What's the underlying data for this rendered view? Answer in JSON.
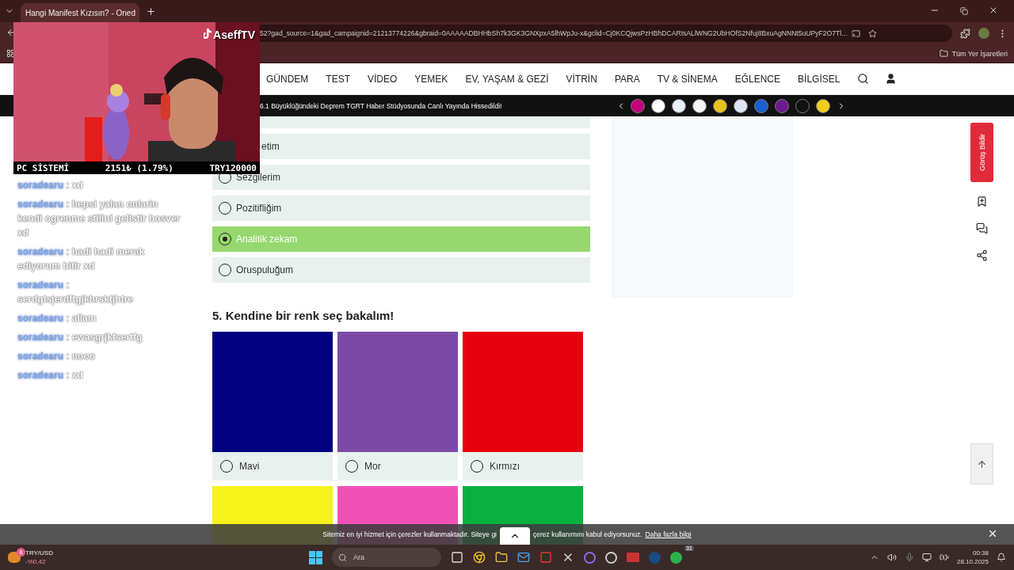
{
  "browser": {
    "tab_title": "Hangi Manifest Kızısın? - Oned",
    "url": "52?gad_source=1&gad_campaignid=21213774226&gbraid=0AAAAADBHHbSh7k3GK3GNXpxA5lhWpJu-x&gclid=Cj0KCQjwsPzHBhDCARIsALlWNG2UbHOfS2Nfuj8BxuAgNNNt5uUPyF2O7Tl...",
    "bookmarks_label": "Tüm Yer İşaretleri"
  },
  "stream_overlay": {
    "channel": "AseffTV",
    "ticker": [
      "PC SİSTEMİ",
      "2151₺ (1.79%)",
      "TRY120000"
    ]
  },
  "site_nav": {
    "items": [
      "GÜNDEM",
      "TEST",
      "VİDEO",
      "YEMEK",
      "EV, YAŞAM & GEZİ",
      "VİTRİN",
      "PARA",
      "TV & SİNEMA",
      "EĞLENCE",
      "BİLGİSEL"
    ]
  },
  "news_ticker": {
    "headline": "6.1 Büyüklüğündeki Deprem TGRT Haber Stüdyosunda Canlı Yayında Hissedildi!",
    "logos": [
      {
        "color": "#c0007a"
      },
      {
        "color": "#ffffff"
      },
      {
        "color": "#e8f0fa"
      },
      {
        "color": "#f4f4f4"
      },
      {
        "color": "#e8c21a"
      },
      {
        "color": "#dfe6f2"
      },
      {
        "color": "#1a5fd0"
      },
      {
        "color": "#6b1d8f"
      },
      {
        "color": "#111111"
      },
      {
        "color": "#f2cf1d"
      }
    ]
  },
  "chat": [
    {
      "user": "soradearu",
      "separator": ":",
      "text": "xd"
    },
    {
      "user": "soradearu",
      "separator": ":",
      "text": "hepsi yalan onlarin kendi ogrenme stilini gelistir bosver xd"
    },
    {
      "user": "soradearu",
      "separator": ":",
      "text": "hadi hadi merak ediyorum bitir xd"
    },
    {
      "user": "soradearu",
      "separator": ":",
      "text": "serdgtsjerdftgjkhrsktjhtre"
    },
    {
      "user": "soradearu",
      "separator": ":",
      "text": "allam"
    },
    {
      "user": "soradearu",
      "separator": ":",
      "text": "ewasgrjkfsertfg"
    },
    {
      "user": "soradearu",
      "separator": ":",
      "text": "nooo"
    },
    {
      "user": "soradearu",
      "separator": ":",
      "text": "xd"
    }
  ],
  "quiz": {
    "options": [
      {
        "kind": "blank"
      },
      {
        "label": "etim",
        "kind": "cut"
      },
      {
        "label": "Sezgilerim",
        "kind": "radio",
        "selected": false
      },
      {
        "label": "Pozitifliğim",
        "kind": "radio",
        "selected": false
      },
      {
        "label": "Analitik zekam",
        "kind": "radio",
        "selected": true
      },
      {
        "label": "Oruspuluğum",
        "kind": "radio",
        "selected": false
      }
    ],
    "question": "5. Kendine bir renk seç bakalım!",
    "color_options": [
      {
        "label": "Mavi",
        "color": "#000080",
        "selected": false
      },
      {
        "label": "Mor",
        "color": "#7b4aa6",
        "selected": false
      },
      {
        "label": "Kırmızı",
        "color": "#e8000e",
        "selected": false
      },
      {
        "color": "#f5f11b"
      },
      {
        "color": "#f052b4"
      },
      {
        "color": "#0bb140"
      }
    ]
  },
  "feedback_button": "Görüş Bildir",
  "cookie_notice": {
    "text_before": "Sitemiz en iyi hizmet için çerezler kullanmaktadır. Siteye gi",
    "text_after": "çerez kullanımını kabul ediyorsunuz.",
    "link": "Daha fazla bilgi"
  },
  "taskbar": {
    "widget_badge": "8",
    "widget_title": "TRY/USD",
    "widget_value": "-%0,42",
    "search_placeholder": "Ara",
    "whatsapp_badge": "31",
    "time": "00:38",
    "date": "28.10.2025"
  }
}
